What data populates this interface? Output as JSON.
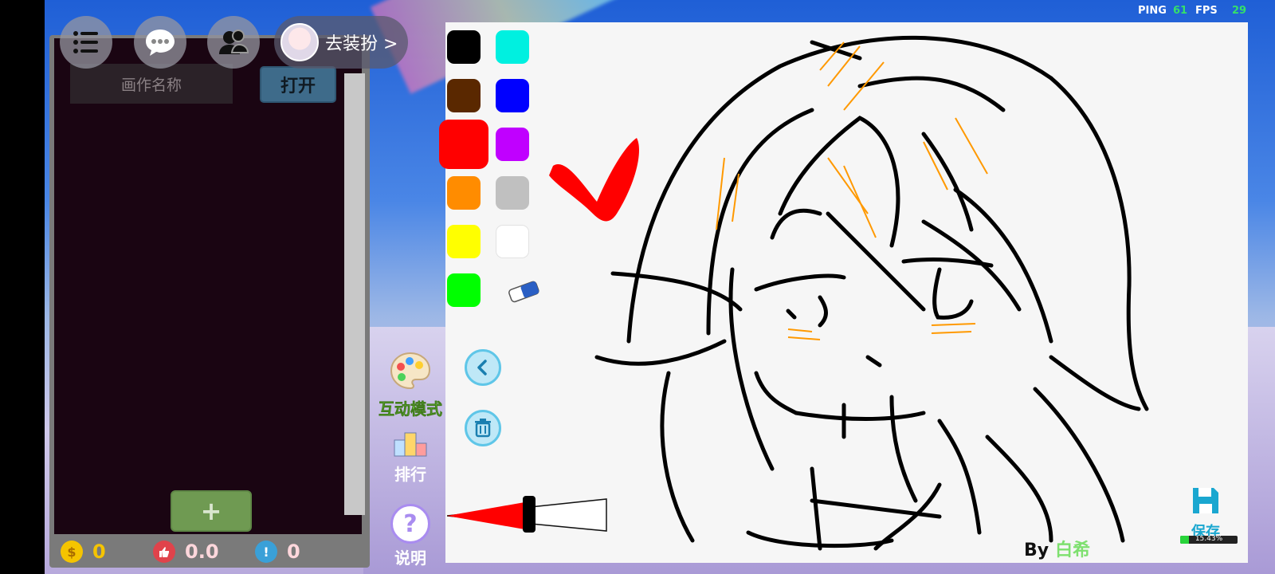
{
  "hud": {
    "ping_label": "PING",
    "ping_value": "61",
    "fps_label": "FPS",
    "fps_value": "29"
  },
  "top_buttons": {
    "menu_icon": "list-icon",
    "chat_icon": "chat-bubble-icon",
    "friends_icon": "friends-icon",
    "dressup_label": "去装扮 >"
  },
  "left_panel": {
    "name_placeholder": "画作名称",
    "open_label": "打开",
    "add_label": "+",
    "stats": {
      "coins": "0",
      "likes": "0.0",
      "reports": "0"
    }
  },
  "side_menu": {
    "interactive_label": "互动模式",
    "rank_label": "排行",
    "help_label": "说明",
    "help_icon_glyph": "?"
  },
  "palette": {
    "colors": [
      "#000000",
      "#00f0e0",
      "#5a2800",
      "#0000ff",
      "#ff0000",
      "#c000ff",
      "#ff8c00",
      "#c0c0c0",
      "#ffff00",
      "#ffffff",
      "#00ff00"
    ],
    "selected": "#ff0000",
    "eraser_icon": "eraser-icon"
  },
  "tools": {
    "undo_icon": "back-arrow-icon",
    "clear_icon": "trash-icon"
  },
  "brush_size": 0.5,
  "canvas": {
    "by_label": "By",
    "author": "白希",
    "save_label": "保存",
    "progress_text": "15.43%",
    "progress_value": 0.1543
  },
  "colors": {
    "accent": "#1aa7d0",
    "coins": "#f5c400",
    "likes": "#e0434b",
    "reports": "#3aa0d8"
  }
}
